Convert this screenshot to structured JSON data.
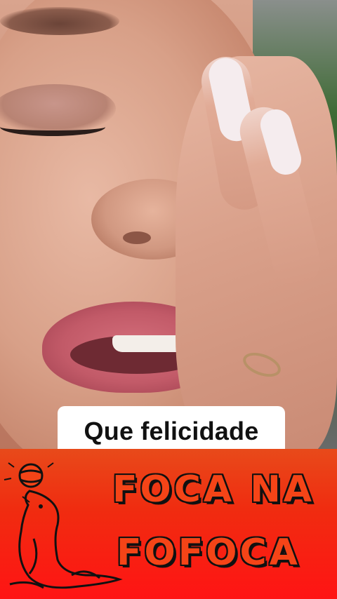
{
  "caption": {
    "text": "Que felicidade"
  },
  "branding": {
    "line1": "FOCA NA",
    "line2": "FOFOCA",
    "mascot_icon": "seal-balancing-ball-icon"
  },
  "colors": {
    "banner_top": "#e84a1a",
    "banner_bottom": "#ff1414",
    "brand_text": "#f54417",
    "outline": "#111111",
    "caption_bg": "#ffffff"
  }
}
